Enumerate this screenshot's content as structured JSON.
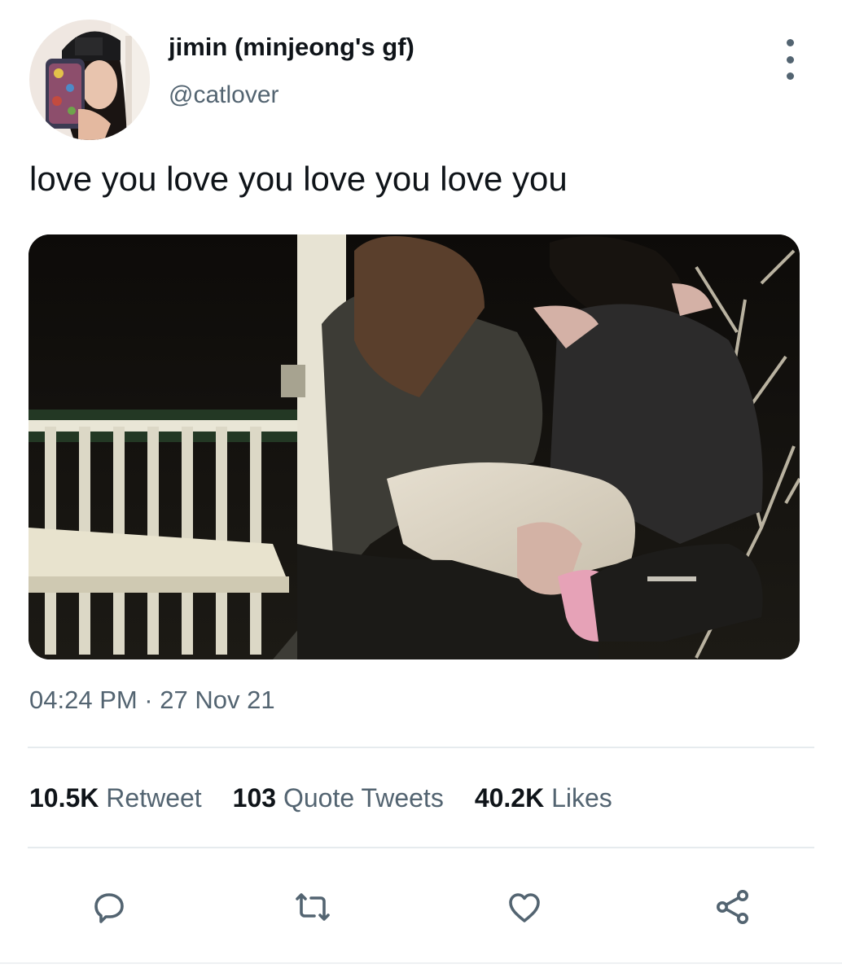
{
  "user": {
    "display_name": "jimin (minjeong's gf)",
    "handle": "@catlover"
  },
  "tweet": {
    "text": "love you love you love you love you",
    "timestamp": "04:24 PM · 27 Nov 21"
  },
  "stats": [
    {
      "count": "10.5K",
      "label": "Retweet"
    },
    {
      "count": "103",
      "label": "Quote Tweets"
    },
    {
      "count": "40.2K",
      "label": "Likes"
    }
  ],
  "icons": {
    "more": "more-vertical-icon",
    "reply": "reply-icon",
    "retweet": "retweet-icon",
    "like": "heart-icon",
    "share": "share-icon"
  },
  "colors": {
    "text_primary": "#0f1419",
    "text_secondary": "#536471",
    "divider": "#e6ebee"
  }
}
